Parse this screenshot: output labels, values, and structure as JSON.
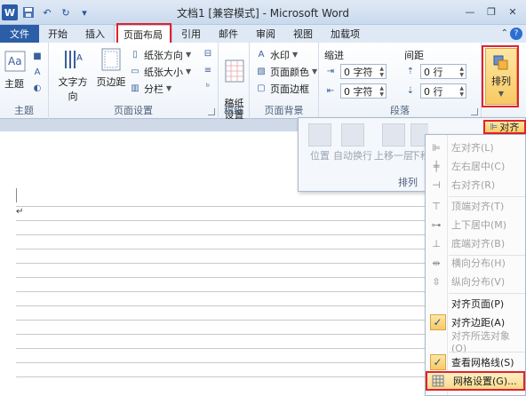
{
  "window": {
    "title": "文档1 [兼容模式] - Microsoft Word",
    "logo": "W"
  },
  "tabs": [
    {
      "label": "文件"
    },
    {
      "label": "开始"
    },
    {
      "label": "插入"
    },
    {
      "label": "页面布局"
    },
    {
      "label": "引用"
    },
    {
      "label": "邮件"
    },
    {
      "label": "审阅"
    },
    {
      "label": "视图"
    },
    {
      "label": "加载项"
    }
  ],
  "ribbon": {
    "theme": {
      "button": "主题",
      "group": "主题"
    },
    "page_setup": {
      "text_direction": "文字方向",
      "margins": "页边距",
      "orientation": "纸张方向",
      "size": "纸张大小",
      "columns": "分栏",
      "group": "页面设置"
    },
    "manuscript": {
      "button": "稿纸\n设置",
      "group": "稿纸"
    },
    "page_background": {
      "watermark": "水印",
      "page_color": "页面颜色",
      "page_borders": "页面边框",
      "group": "页面背景"
    },
    "paragraph": {
      "indent_label": "缩进",
      "spacing_label": "间距",
      "indent_left": "0 字符",
      "indent_right": "0 字符",
      "spacing_before": "0 行",
      "spacing_after": "0 行",
      "group": "段落"
    },
    "arrange": {
      "button": "排列"
    }
  },
  "arrange_flyout": {
    "position": "位置",
    "wrap_text": "自动换行",
    "bring_forward": "上移一层",
    "send_backward": "下移",
    "group_label": "排列",
    "align_button": "对齐"
  },
  "align_menu": {
    "items": [
      {
        "label": "左对齐(L)",
        "enabled": false
      },
      {
        "label": "左右居中(C)",
        "enabled": false
      },
      {
        "label": "右对齐(R)",
        "enabled": false
      },
      {
        "label": "顶端对齐(T)",
        "enabled": false
      },
      {
        "label": "上下居中(M)",
        "enabled": false
      },
      {
        "label": "底端对齐(B)",
        "enabled": false
      },
      {
        "label": "横向分布(H)",
        "enabled": false
      },
      {
        "label": "纵向分布(V)",
        "enabled": false
      },
      {
        "label": "对齐页面(P)",
        "enabled": true
      },
      {
        "label": "对齐边距(A)",
        "enabled": true,
        "checked": true
      },
      {
        "label": "对齐所选对象(O)",
        "enabled": false
      },
      {
        "label": "查看网格线(S)",
        "enabled": true,
        "checked": true
      },
      {
        "label": "网格设置(G)...",
        "enabled": true,
        "highlighted": true
      }
    ]
  },
  "colors": {
    "accent_red": "#e3222a",
    "file_tab": "#2c5ea7",
    "highlight": "#f8c964"
  }
}
